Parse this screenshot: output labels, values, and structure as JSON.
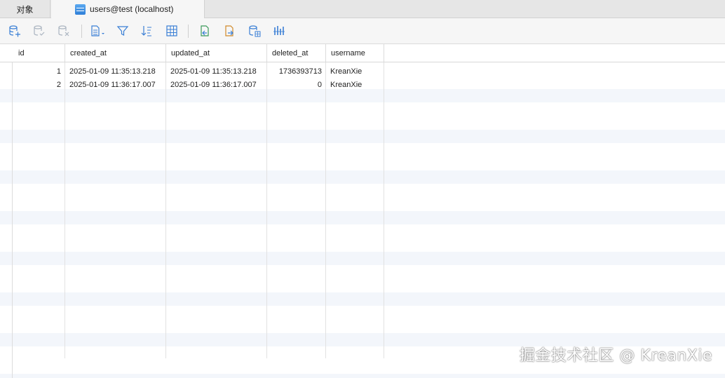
{
  "tabs": {
    "objects": "对象",
    "active": "users@test (localhost)"
  },
  "toolbar": {
    "icons": [
      "add-record-icon",
      "save-record-icon",
      "delete-record-icon",
      "text-view-icon",
      "filter-icon",
      "sort-icon",
      "grid-view-icon",
      "import-icon",
      "export-icon",
      "data-generation-icon",
      "chart-icon"
    ]
  },
  "table": {
    "columns": [
      "id",
      "created_at",
      "updated_at",
      "deleted_at",
      "username"
    ],
    "rows": [
      [
        "1",
        "2025-01-09 11:35:13.218",
        "2025-01-09 11:35:13.218",
        "1736393713",
        "KreanXie"
      ],
      [
        "2",
        "2025-01-09 11:36:17.007",
        "2025-01-09 11:36:17.007",
        "0",
        "KreanXie"
      ]
    ]
  },
  "watermark": "掘金技术社区 @ KreanXie",
  "colors": {
    "accent": "#2f7fd8",
    "stripe": "#f3f6fb"
  }
}
